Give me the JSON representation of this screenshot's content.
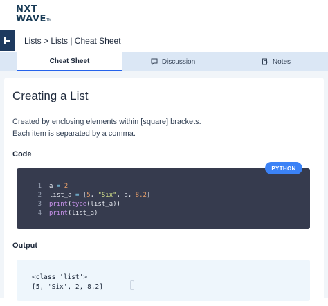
{
  "brand": {
    "line1": "NXT",
    "line2": "WAVE",
    "tm": "TM"
  },
  "breadcrumb": {
    "text": "Lists > Lists | Cheat Sheet"
  },
  "tabs": [
    {
      "label": "Cheat Sheet",
      "active": true,
      "icon": ""
    },
    {
      "label": "Discussion",
      "active": false,
      "icon": "chat-icon"
    },
    {
      "label": "Notes",
      "active": false,
      "icon": "notes-icon"
    }
  ],
  "main": {
    "title": "Creating a List",
    "desc_line1": "Created by enclosing elements within [square] brackets.",
    "desc_line2": "Each item is separated by a comma.",
    "code_label": "Code",
    "language": "PYTHON",
    "output_label": "Output"
  },
  "code": {
    "lines": [
      {
        "no": "1",
        "text": "a = 2"
      },
      {
        "no": "2",
        "text": "list_a = [5, \"Six\", a, 8.2]"
      },
      {
        "no": "3",
        "text": "print(type(list_a))"
      },
      {
        "no": "4",
        "text": "print(list_a)"
      }
    ]
  },
  "output": {
    "lines": [
      "<class 'list'>",
      "[5, 'Six', 2, 8.2]"
    ]
  },
  "colors": {
    "accent": "#3b82f6",
    "code_bg": "#363b4e",
    "output_bg": "#eef6fc",
    "tabs_bg": "#dbe7f5",
    "sidebar_toggle": "#1e3a5f"
  }
}
